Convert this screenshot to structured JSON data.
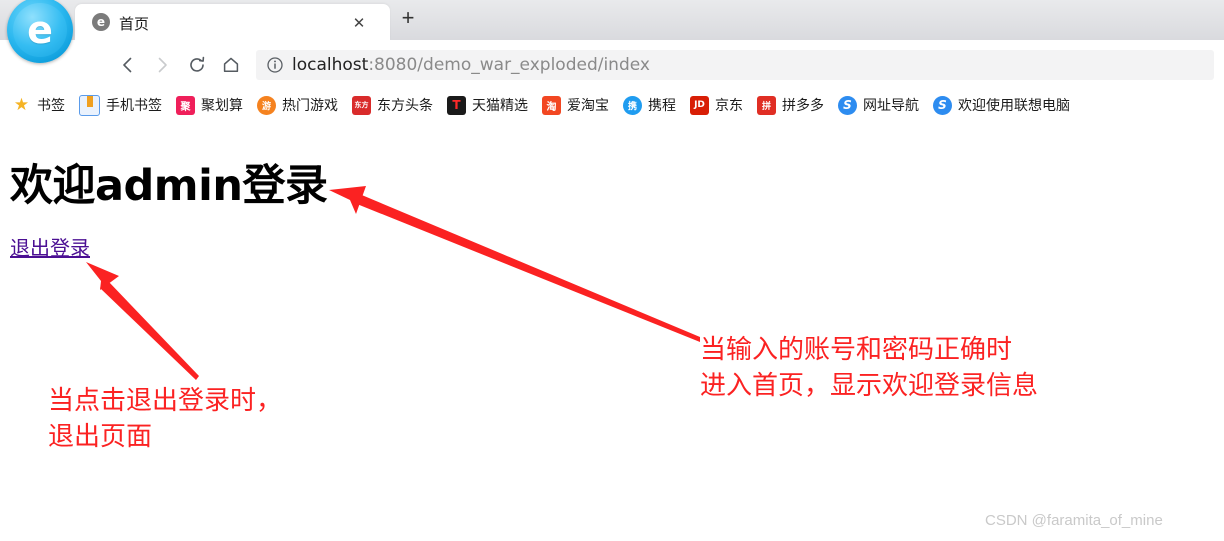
{
  "browser": {
    "logo_icon": "browser-logo-e-icon",
    "logo_glyph": "e",
    "tab": {
      "favicon": "tab-favicon-e-icon",
      "favicon_glyph": "e",
      "title": "首页",
      "close_label": "✕"
    },
    "new_tab_label": "+",
    "nav": {
      "back_icon": "back-arrow-icon",
      "forward_icon": "forward-arrow-icon",
      "reload_icon": "reload-icon",
      "home_icon": "home-icon"
    },
    "omnibox": {
      "info_icon": "site-info-icon",
      "host": "localhost",
      "path": ":8080/demo_war_exploded/index",
      "full_url": "localhost:8080/demo_war_exploded/index"
    },
    "bookmarks": [
      {
        "label": "书签",
        "icon": "star-icon",
        "glyph": "★",
        "bg": "transparent",
        "fg": "#f5b324"
      },
      {
        "label": "手机书签",
        "icon": "mobile-bookmark-icon",
        "glyph": "❚",
        "bg": "#e8f1fd",
        "fg": "#f0a020"
      },
      {
        "label": "聚划算",
        "icon": "juhuasuan-icon",
        "glyph": "聚",
        "bg": "#ef1f5a",
        "fg": "#ffffff"
      },
      {
        "label": "热门游戏",
        "icon": "hot-games-icon",
        "glyph": "游",
        "bg": "#f5821f",
        "fg": "#ffffff"
      },
      {
        "label": "东方头条",
        "icon": "dongfang-toutiao-icon",
        "glyph": "东方",
        "bg": "#d92b2b",
        "fg": "#ffffff"
      },
      {
        "label": "天猫精选",
        "icon": "tmall-icon",
        "glyph": "T",
        "bg": "#1a1a1a",
        "fg": "#ff2a2a"
      },
      {
        "label": "爱淘宝",
        "icon": "taobao-icon",
        "glyph": "淘",
        "bg": "#f24722",
        "fg": "#ffffff"
      },
      {
        "label": "携程",
        "icon": "ctrip-icon",
        "glyph": "携",
        "bg": "#1f9cf0",
        "fg": "#ffffff"
      },
      {
        "label": "京东",
        "icon": "jd-icon",
        "glyph": "JD",
        "bg": "#d81e06",
        "fg": "#ffffff"
      },
      {
        "label": "拼多多",
        "icon": "pinduoduo-icon",
        "glyph": "拼",
        "bg": "#e02e24",
        "fg": "#ffffff"
      },
      {
        "label": "网址导航",
        "icon": "site-navigation-icon",
        "glyph": "S",
        "bg": "#2d8cf0",
        "fg": "#ffffff"
      },
      {
        "label": "欢迎使用联想电脑",
        "icon": "lenovo-welcome-icon",
        "glyph": "S",
        "bg": "#2d8cf0",
        "fg": "#ffffff"
      }
    ]
  },
  "page": {
    "heading": "欢迎admin登录",
    "logout_link": "退出登录"
  },
  "annotations": {
    "right": "当输入的账号和密码正确时\n进入首页，显示欢迎登录信息",
    "left": "当点击退出登录时，\n退出页面",
    "color": "#fb2222"
  },
  "watermark": "CSDN @faramita_of_mine"
}
